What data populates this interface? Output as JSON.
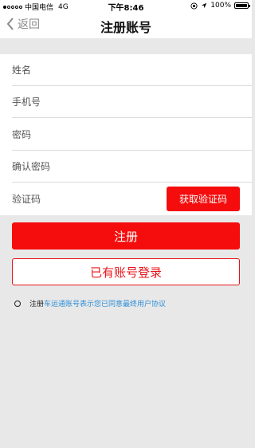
{
  "status_bar": {
    "carrier": "中国电信",
    "network": "4G",
    "time": "下午8:46",
    "battery": "100%"
  },
  "nav": {
    "back_label": "返回",
    "title": "注册账号"
  },
  "form": {
    "name_placeholder": "姓名",
    "phone_placeholder": "手机号",
    "password_placeholder": "密码",
    "confirm_password_placeholder": "确认密码",
    "code_placeholder": "验证码",
    "get_code_label": "获取验证码"
  },
  "actions": {
    "register_label": "注册",
    "login_label": "已有账号登录"
  },
  "agreement": {
    "prefix": "注册",
    "link_text": "车运通账号表示您已同意最终用户协议"
  },
  "colors": {
    "primary_red": "#f50d0d",
    "link_blue": "#2f8fd8",
    "background": "#e8e8e8"
  }
}
